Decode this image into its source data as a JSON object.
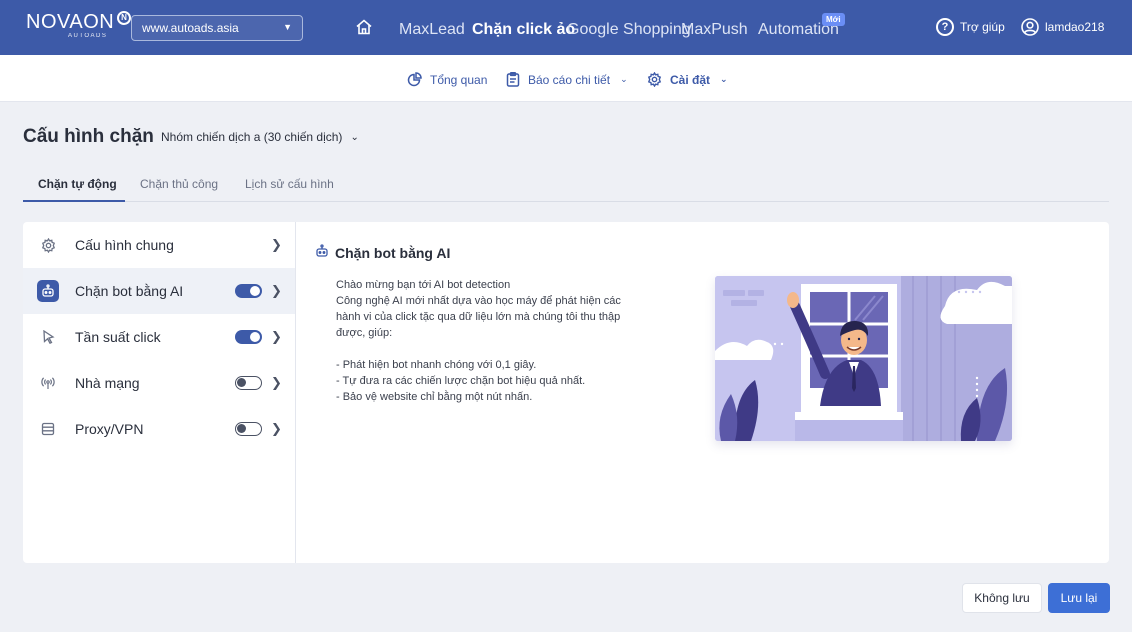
{
  "topbar": {
    "logo_text": "NOVAON",
    "logo_sub": "AUTOADS",
    "domain": "www.autoads.asia",
    "nav": [
      {
        "label": "MaxLead",
        "active": false
      },
      {
        "label": "Chặn click ảo",
        "active": true
      },
      {
        "label": "Google Shopping",
        "active": false
      },
      {
        "label": "MaxPush",
        "active": false
      },
      {
        "label": "Automation",
        "active": false
      }
    ],
    "new_badge": "Mới",
    "help_label": "Trợ giúp",
    "username": "lamdao218"
  },
  "subnav": {
    "items": [
      {
        "label": "Tổng quan",
        "icon": "chart-pie-icon"
      },
      {
        "label": "Báo cáo chi tiết",
        "icon": "clipboard-icon"
      },
      {
        "label": "Cài đặt",
        "icon": "gear-icon"
      }
    ]
  },
  "page": {
    "title": "Cấu hình chặn",
    "group": "Nhóm chiến dịch a (30 chiến dịch)",
    "tabs": [
      "Chặn tự động",
      "Chặn thủ công",
      "Lịch sử cấu hình"
    ]
  },
  "sidebar": {
    "items": [
      {
        "label": "Cấu hình chung",
        "icon": "gear-icon",
        "toggle": null
      },
      {
        "label": "Chặn bot bằng AI",
        "icon": "robot-icon",
        "toggle": "on"
      },
      {
        "label": "Tần suất click",
        "icon": "cursor-icon",
        "toggle": "on"
      },
      {
        "label": "Nhà mạng",
        "icon": "antenna-icon",
        "toggle": "off"
      },
      {
        "label": "Proxy/VPN",
        "icon": "server-icon",
        "toggle": "off"
      }
    ]
  },
  "content": {
    "title": "Chặn bot bằng AI",
    "lines": [
      "Chào mừng bạn tới AI bot detection",
      "Công nghệ AI mới nhất dựa vào học máy để phát hiện các hành vi của click tặc qua dữ liệu lớn mà chúng tôi thu thập được, giúp:"
    ],
    "bullets": [
      "- Phát hiện bot nhanh chóng với 0,1 giây.",
      "- Tự đưa ra các chiến lược chặn bot hiệu quả nhất.",
      "- Bảo vệ website chỉ bằng một nút nhấn."
    ]
  },
  "actions": {
    "cancel": "Không lưu",
    "save": "Lưu lại"
  },
  "colors": {
    "primary": "#3d5aa8",
    "save_button": "#3d6fd6",
    "illustration_bg": "#c4c4ec"
  }
}
